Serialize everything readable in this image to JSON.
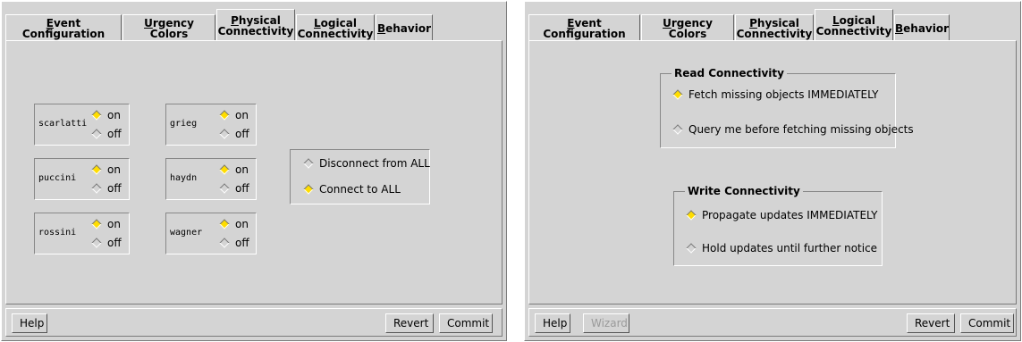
{
  "left": {
    "tabs": [
      {
        "pre": "",
        "ul": "E",
        "post": "vent Configuration"
      },
      {
        "pre": "",
        "ul": "U",
        "post": "rgency Colors"
      },
      {
        "line1_pre": "",
        "line1_ul": "P",
        "line1_post": "hysical",
        "line2": "Connectivity"
      },
      {
        "line1_pre": "",
        "line1_ul": "L",
        "line1_post": "ogical",
        "line2": "Connectivity"
      },
      {
        "pre": "",
        "ul": "B",
        "post": "ehavior"
      }
    ],
    "hosts": [
      {
        "name": "scarlatti",
        "on": "on",
        "off": "off",
        "selected": "on"
      },
      {
        "name": "grieg",
        "on": "on",
        "off": "off",
        "selected": "on"
      },
      {
        "name": "puccini",
        "on": "on",
        "off": "off",
        "selected": "on"
      },
      {
        "name": "haydn",
        "on": "on",
        "off": "off",
        "selected": "on"
      },
      {
        "name": "rossini",
        "on": "on",
        "off": "off",
        "selected": "on"
      },
      {
        "name": "wagner",
        "on": "on",
        "off": "off",
        "selected": "on"
      }
    ],
    "all": {
      "disconnect": "Disconnect from ALL",
      "connect": "Connect to ALL",
      "selected": "connect"
    },
    "footer": {
      "help": "Help",
      "revert": "Revert",
      "commit": "Commit"
    }
  },
  "right": {
    "tabs": [
      {
        "pre": "",
        "ul": "E",
        "post": "vent Configuration"
      },
      {
        "pre": "",
        "ul": "U",
        "post": "rgency Colors"
      },
      {
        "line1_pre": "",
        "line1_ul": "P",
        "line1_post": "hysical",
        "line2": "Connectivity"
      },
      {
        "line1_pre": "",
        "line1_ul": "L",
        "line1_post": "ogical",
        "line2": "Connectivity"
      },
      {
        "pre": "",
        "ul": "B",
        "post": "ehavior"
      }
    ],
    "read": {
      "title": "Read Connectivity",
      "opt1": "Fetch missing objects IMMEDIATELY",
      "opt2": "Query me before fetching missing objects",
      "selected": "opt1"
    },
    "write": {
      "title": "Write Connectivity",
      "opt1": "Propagate updates IMMEDIATELY",
      "opt2": "Hold updates until further notice",
      "selected": "opt1"
    },
    "footer": {
      "help": "Help",
      "wizard": "Wizard",
      "revert": "Revert",
      "commit": "Commit"
    }
  },
  "colors": {
    "panel": "#d4d4d4",
    "radio_on": "#ffdd00"
  }
}
